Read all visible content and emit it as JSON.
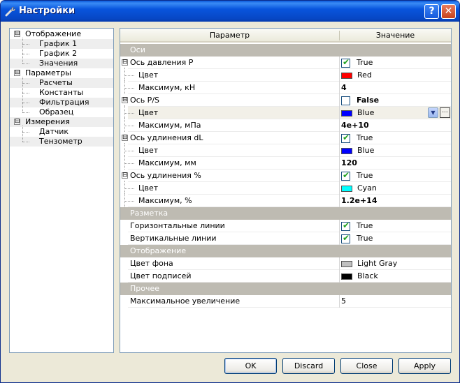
{
  "window": {
    "title": "Настройки",
    "help_label": "?",
    "close_label": "✕"
  },
  "tree": {
    "items": [
      {
        "label": "Отображение",
        "expander": "⊟"
      },
      {
        "label": "График 1"
      },
      {
        "label": "График 2"
      },
      {
        "label": "Значения"
      },
      {
        "label": "Параметры",
        "expander": "⊟"
      },
      {
        "label": "Расчеты"
      },
      {
        "label": "Константы"
      },
      {
        "label": "Фильтрация"
      },
      {
        "label": "Образец"
      },
      {
        "label": "Измерения",
        "expander": "⊟"
      },
      {
        "label": "Датчик"
      },
      {
        "label": "Тензометр"
      }
    ]
  },
  "grid": {
    "headers": {
      "param": "Параметр",
      "value": "Значение"
    },
    "rows": [
      {
        "type": "category",
        "label": "Оси"
      },
      {
        "name": "Ось давления P",
        "expander": "⊟",
        "check": true,
        "value": "True"
      },
      {
        "name": "Цвет",
        "swatch": "#FF0000",
        "value": "Red"
      },
      {
        "name": "Максимум, кН",
        "value": "4"
      },
      {
        "name": "Ось P/S",
        "expander": "⊟",
        "check": false,
        "value": "False"
      },
      {
        "name": "Цвет",
        "swatch": "#0000FF",
        "value": "Blue"
      },
      {
        "name": "Максимум, мПа",
        "value": "4e+10"
      },
      {
        "name": "Ось удлинения dL",
        "expander": "⊟",
        "check": true,
        "value": "True"
      },
      {
        "name": "Цвет",
        "swatch": "#0000FF",
        "value": "Blue"
      },
      {
        "name": "Максимум, мм",
        "value": "120"
      },
      {
        "name": "Ось удлинения %",
        "expander": "⊟",
        "check": true,
        "value": "True"
      },
      {
        "name": "Цвет",
        "swatch": "#00FFFF",
        "value": "Cyan"
      },
      {
        "name": "Максимум, %",
        "value": "1.2e+14"
      },
      {
        "type": "category",
        "label": "Разметка"
      },
      {
        "name": "Горизонтальные линии",
        "check": true,
        "value": "True"
      },
      {
        "name": "Вертикальные линии",
        "check": true,
        "value": "True"
      },
      {
        "type": "category",
        "label": "Отображение"
      },
      {
        "name": "Цвет фона",
        "swatch": "#C0C0C0",
        "value": "Light Gray"
      },
      {
        "name": "Цвет подписей",
        "swatch": "#000000",
        "value": "Black"
      },
      {
        "type": "category",
        "label": "Прочее"
      },
      {
        "name": "Максимальное увеличение",
        "value": "5"
      }
    ]
  },
  "buttons": {
    "ok": "OK",
    "discard": "Discard",
    "close": "Close",
    "apply": "Apply"
  },
  "controls": {
    "combo_arrow": "▼",
    "ellipsis": "..."
  }
}
